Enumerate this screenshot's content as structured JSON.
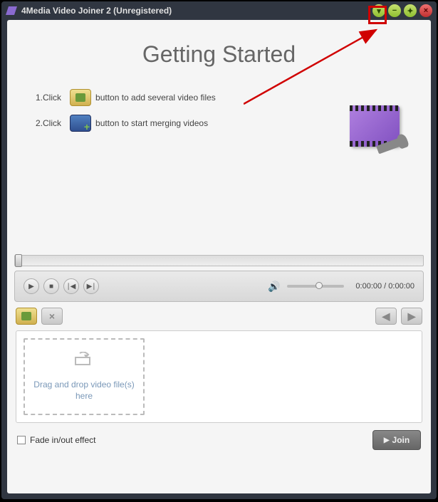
{
  "titlebar": {
    "title": "4Media Video Joiner 2 (Unregistered)"
  },
  "getting_started": {
    "heading": "Getting Started",
    "step1_prefix": "1.Click",
    "step1_suffix": "button to add several video files",
    "step2_prefix": "2.Click",
    "step2_suffix": "button to start merging videos"
  },
  "player": {
    "time": "0:00:00 / 0:00:00"
  },
  "dropzone": {
    "text": "Drag and drop video file(s) here"
  },
  "bottom": {
    "fade_label": "Fade in/out effect",
    "join_label": "Join"
  }
}
